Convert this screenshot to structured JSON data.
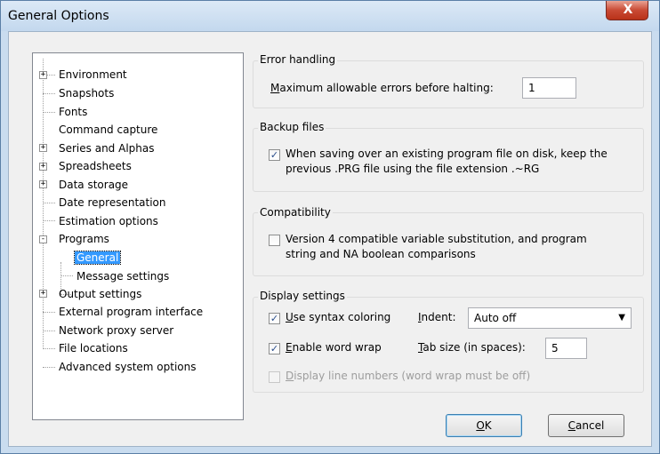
{
  "window": {
    "title": "General Options",
    "close_glyph": "X"
  },
  "tree": [
    {
      "label": "Environment",
      "expander": "+"
    },
    {
      "label": "Snapshots"
    },
    {
      "label": "Fonts"
    },
    {
      "label": "Command capture"
    },
    {
      "label": "Series and Alphas",
      "expander": "+"
    },
    {
      "label": "Spreadsheets",
      "expander": "+"
    },
    {
      "label": "Data storage",
      "expander": "+"
    },
    {
      "label": "Date representation"
    },
    {
      "label": "Estimation options"
    },
    {
      "label": "Programs",
      "expander": "-"
    },
    {
      "label": "General",
      "selected": true
    },
    {
      "label": "Message settings"
    },
    {
      "label": "Output settings",
      "expander": "+"
    },
    {
      "label": "External program interface"
    },
    {
      "label": "Network proxy server"
    },
    {
      "label": "File locations"
    },
    {
      "label": "Advanced system options"
    }
  ],
  "error_handling": {
    "title": "Error handling",
    "max_errors_label_accel": "M",
    "max_errors_label_rest": "aximum allowable errors before halting:",
    "max_errors_value": "1"
  },
  "backup": {
    "title": "Backup files",
    "checked": true,
    "line1": "When saving over an existing program file on disk, keep the",
    "line2": "previous .PRG file using the file extension  .~RG"
  },
  "compat": {
    "title": "Compatibility",
    "checked": false,
    "line1": "Version 4 compatible variable substitution, and program",
    "line2": "string and NA boolean comparisons"
  },
  "display": {
    "title": "Display settings",
    "syntax_accel": "U",
    "syntax_rest": "se syntax coloring",
    "syntax_checked": true,
    "indent_accel": "I",
    "indent_rest": "ndent:",
    "indent_value": "Auto off",
    "wrap_accel": "E",
    "wrap_rest": "nable word wrap",
    "wrap_checked": true,
    "tab_accel": "T",
    "tab_rest": "ab size (in spaces):",
    "tab_value": "5",
    "linenum_accel": "D",
    "linenum_rest": "isplay line numbers (word wrap must be off)",
    "linenum_checked": false
  },
  "buttons": {
    "ok_accel": "O",
    "ok_rest": "K",
    "cancel_accel": "C",
    "cancel_rest": "ancel"
  },
  "icons": {
    "check": "✓",
    "dropdown": "▼"
  }
}
